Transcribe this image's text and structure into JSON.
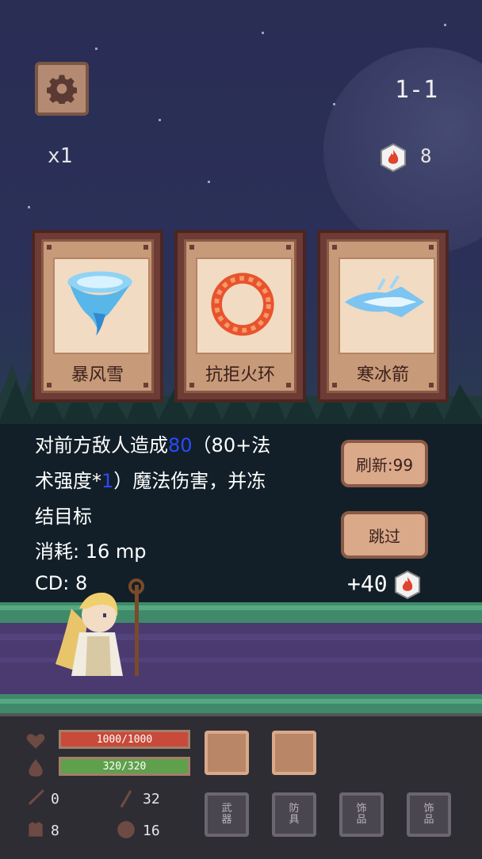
{
  "hud": {
    "speed": "x1",
    "stage": "1-1",
    "crystal_count": "8",
    "icons": [
      "gear-icon",
      "fire-crystal-icon"
    ]
  },
  "cards": [
    {
      "name": "暴风雪",
      "art": "tornado-art"
    },
    {
      "name": "抗拒火环",
      "art": "fire-ring-art"
    },
    {
      "name": "寒冰箭",
      "art": "ice-arrow-art"
    }
  ],
  "description": {
    "line1a": "对前方敌人造成",
    "line1hl": "80",
    "line1b": "（80+法",
    "line2a": "术强度*",
    "line2hl": "1",
    "line2b": "）魔法伤害，并冻",
    "line3": "结目标",
    "cost": "消耗: 16 mp",
    "cd": "CD: 8"
  },
  "actions": {
    "refresh": "刷新:99",
    "skip": "跳过",
    "reward": "+40"
  },
  "player": {
    "hp": "1000/1000",
    "mp": "320/320",
    "attack": "0",
    "magic": "32",
    "armor": "8",
    "magic_def": "16"
  },
  "equipment": {
    "slots": [
      "武\n器",
      "防\n具",
      "饰\n品",
      "饰\n品"
    ]
  },
  "colors": {
    "hp": "#c84a3a",
    "mp": "#5fa04c",
    "highlight": "#2a4aff"
  }
}
